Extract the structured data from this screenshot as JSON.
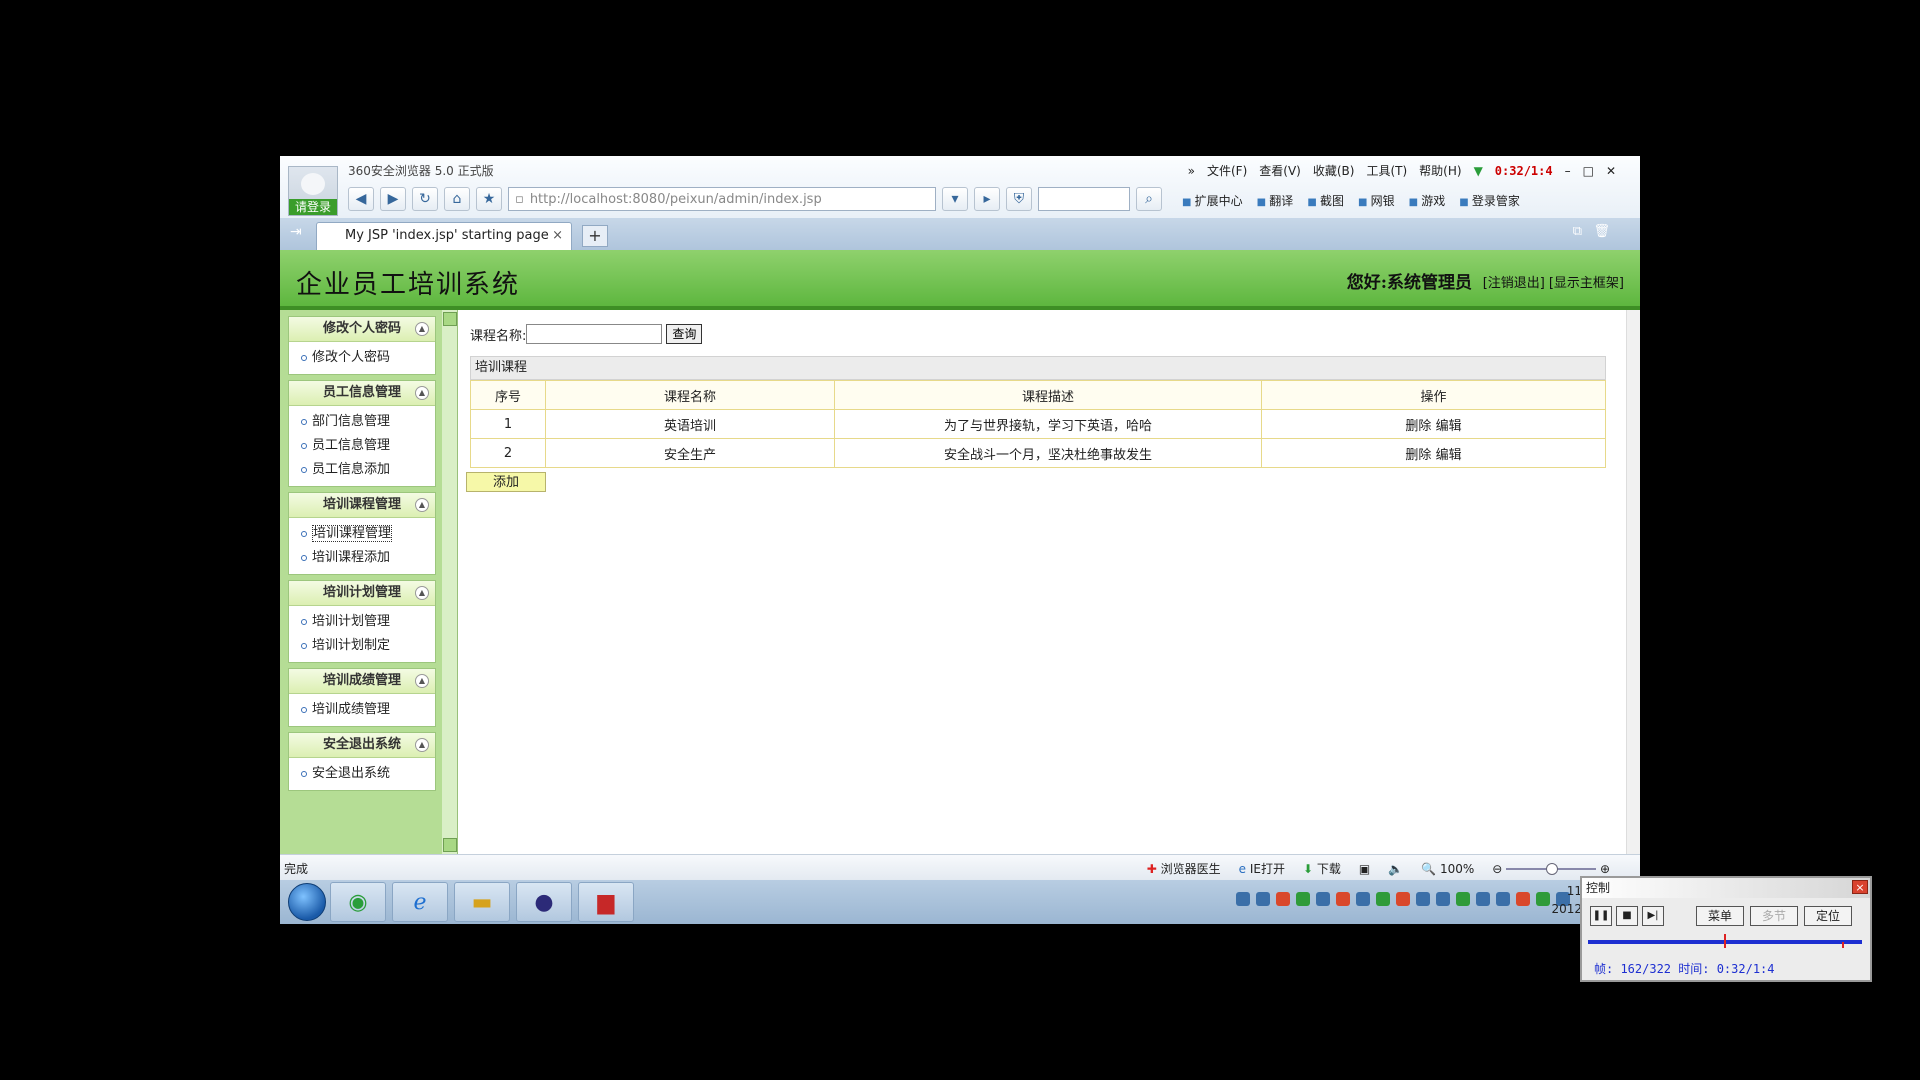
{
  "browser": {
    "login_label": "请登录",
    "app_name": "360安全浏览器 5.0 正式版",
    "menus": [
      "文件(F)",
      "查看(V)",
      "收藏(B)",
      "工具(T)",
      "帮助(H)"
    ],
    "recording_timer": "0:32/1:4",
    "url_host": "http://localhost",
    "url_rest": ":8080/peixun/admin/index.jsp",
    "tools": [
      "扩展中心",
      "翻译",
      "截图",
      "网银",
      "游戏",
      "登录管家"
    ],
    "tab_title": "My JSP 'index.jsp' starting page",
    "tab_close": "×",
    "new_tab": "+"
  },
  "header": {
    "system_name": "企业员工培训系统",
    "greeting": "您好:系统管理员",
    "logout_link": "[注销退出]",
    "show_frame_link": "[显示主框架]"
  },
  "sidebar": {
    "groups": [
      {
        "title": "修改个人密码",
        "items": [
          "修改个人密码"
        ]
      },
      {
        "title": "员工信息管理",
        "items": [
          "部门信息管理",
          "员工信息管理",
          "员工信息添加"
        ]
      },
      {
        "title": "培训课程管理",
        "items": [
          "培训课程管理",
          "培训课程添加"
        ]
      },
      {
        "title": "培训计划管理",
        "items": [
          "培训计划管理",
          "培训计划制定"
        ]
      },
      {
        "title": "培训成绩管理",
        "items": [
          "培训成绩管理"
        ]
      },
      {
        "title": "安全退出系统",
        "items": [
          "安全退出系统"
        ]
      }
    ]
  },
  "content": {
    "query_label": "课程名称:",
    "query_value": "",
    "query_button": "查询",
    "panel_title": "培训课程",
    "columns": [
      "序号",
      "课程名称",
      "课程描述",
      "操作"
    ],
    "rows": [
      {
        "no": "1",
        "name": "英语培训",
        "desc": "为了与世界接轨，学习下英语，哈哈",
        "delete": "删除",
        "edit": "编辑"
      },
      {
        "no": "2",
        "name": "安全生产",
        "desc": "安全战斗一个月，坚决杜绝事故发生",
        "delete": "删除",
        "edit": "编辑"
      }
    ],
    "add_button": "添加"
  },
  "statusbar": {
    "status": "完成",
    "doctor": "浏览器医生",
    "ie_open": "IE打开",
    "download": "下载",
    "zoom": "100%"
  },
  "taskbar": {
    "clock_time": "11",
    "clock_date": "2012"
  },
  "control": {
    "title": "控制",
    "close": "×",
    "menu_button": "菜单",
    "multi_button": "多节",
    "locate_button": "定位",
    "info": "帧: 162/322 时间: 0:32/1:4"
  }
}
